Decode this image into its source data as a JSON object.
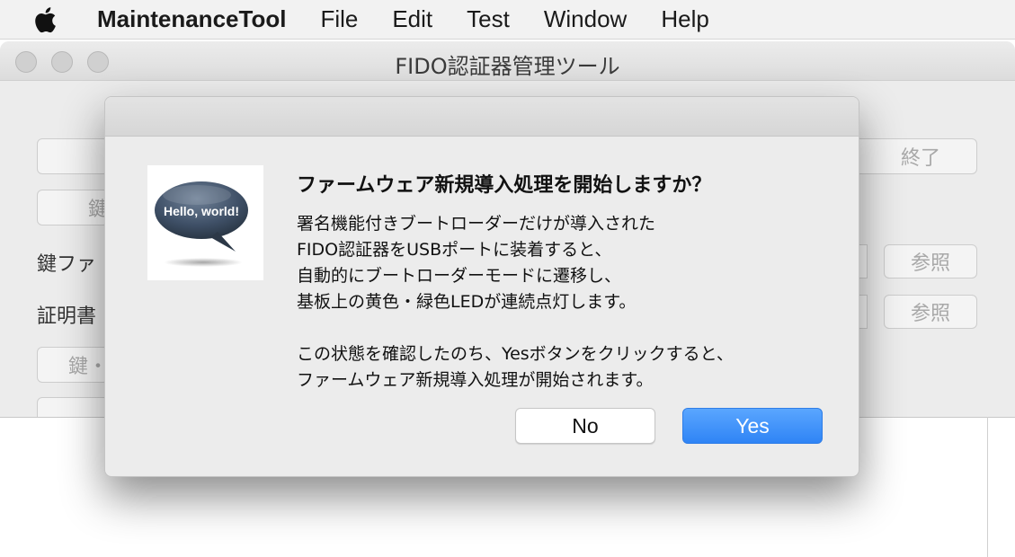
{
  "menubar": {
    "apple_icon": "apple-logo",
    "app_name": "MaintenanceTool",
    "items": [
      "File",
      "Edit",
      "Test",
      "Window",
      "Help"
    ]
  },
  "window": {
    "title": "FIDO認証器管理ツール",
    "quit_button": "終了",
    "key_button_partial": "鍵",
    "key_file_label_partial": "鍵ファ",
    "cert_label_partial": "証明書",
    "browse_button_1": "参照",
    "browse_button_2": "参照",
    "key_cert_button_partial": "鍵・"
  },
  "dialog": {
    "icon_text": "Hello, world!",
    "title": "ファームウェア新規導入処理を開始しますか？",
    "lines": [
      "署名機能付きブートローダーだけが導入された",
      "FIDO認証器をUSBポートに装着すると、",
      "自動的にブートローダーモードに遷移し、",
      "基板上の黄色・緑色LEDが連続点灯します。",
      "",
      "この状態を確認したのち、Yesボタンをクリックすると、",
      "ファームウェア新規導入処理が開始されます。"
    ],
    "no_button": "No",
    "yes_button": "Yes",
    "accent_color": "#3b8cf7"
  }
}
